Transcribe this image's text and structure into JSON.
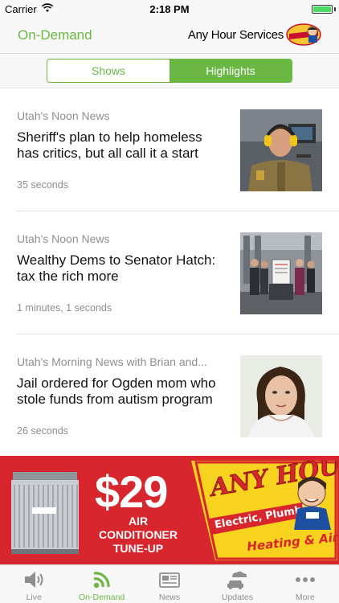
{
  "status_bar": {
    "carrier": "Carrier",
    "time": "2:18 PM",
    "battery_level": 1.0
  },
  "nav": {
    "title": "On-Demand",
    "sponsor_text": "Any Hour Services",
    "sponsor_logo_icon": "any-hour-logo-icon"
  },
  "segments": {
    "items": [
      {
        "label": "Shows",
        "selected": false
      },
      {
        "label": "Highlights",
        "selected": true
      }
    ]
  },
  "stories": [
    {
      "show": "Utah's Noon News",
      "headline": "Sheriff's plan to help homeless has critics, but all call it a start",
      "duration": "35 seconds",
      "thumb_icon": "sheriff-photo-icon"
    },
    {
      "show": "Utah's Noon News",
      "headline": "Wealthy Dems to Senator Hatch: tax the rich more",
      "duration": "1 minutes, 1 seconds",
      "thumb_icon": "protest-photo-icon"
    },
    {
      "show": "Utah's Morning News with Brian and...",
      "headline": "Jail ordered for Ogden mom who stole funds from autism program",
      "duration": "26 seconds",
      "thumb_icon": "mugshot-photo-icon"
    }
  ],
  "ad": {
    "price": "$29",
    "line1": "AIR",
    "line2": "CONDITIONER",
    "line3": "TUNE-UP",
    "logo_text": "ANY HOUR",
    "banner_text": "Electric, Plumbing",
    "sub_text": "Heating & Air"
  },
  "tabs": [
    {
      "label": "Live",
      "icon": "speaker-icon",
      "active": false
    },
    {
      "label": "On-Demand",
      "icon": "podcast-icon",
      "active": true
    },
    {
      "label": "News",
      "icon": "newspaper-icon",
      "active": false
    },
    {
      "label": "Updates",
      "icon": "car-weather-icon",
      "active": false
    },
    {
      "label": "More",
      "icon": "more-icon",
      "active": false
    }
  ],
  "colors": {
    "accent": "#6ab744",
    "ad_red": "#d7262d",
    "secondary_text": "#8e8e8e"
  }
}
